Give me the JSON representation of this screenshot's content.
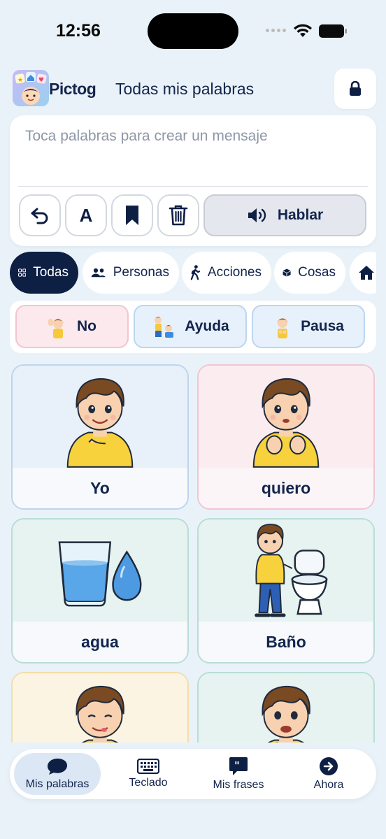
{
  "status_bar": {
    "time": "12:56"
  },
  "header": {
    "logo_text": "Pictog",
    "title": "Todas mis palabras"
  },
  "message": {
    "placeholder": "Toca palabras para crear un mensaje",
    "speak_label": "Hablar",
    "font_button_label": "A"
  },
  "categories": [
    {
      "label": "Todas",
      "icon": "grid-icon",
      "active": true
    },
    {
      "label": "Personas",
      "icon": "people-icon"
    },
    {
      "label": "Acciones",
      "icon": "walking-icon"
    },
    {
      "label": "Cosas",
      "icon": "box-icon"
    },
    {
      "label": "",
      "icon": "home-icon"
    }
  ],
  "quick_chips": [
    {
      "label": "No"
    },
    {
      "label": "Ayuda"
    },
    {
      "label": "Pausa"
    }
  ],
  "cards": [
    {
      "label": "Yo",
      "color": "blue"
    },
    {
      "label": "quiero",
      "color": "pink"
    },
    {
      "label": "agua",
      "color": "teal"
    },
    {
      "label": "Baño",
      "color": "teal"
    },
    {
      "label": "",
      "color": "yellow"
    },
    {
      "label": "",
      "color": "teal"
    }
  ],
  "nav": [
    {
      "label": "Mis palabras",
      "icon": "chat-bubble-icon",
      "active": true
    },
    {
      "label": "Teclado",
      "icon": "keyboard-icon"
    },
    {
      "label": "Mis frases",
      "icon": "quote-bubble-icon"
    },
    {
      "label": "Ahora",
      "icon": "arrow-circle-icon"
    }
  ],
  "colors": {
    "background": "#eaf2f9",
    "navy": "#0e1f44",
    "card_blue": "#e8f0fa",
    "card_pink": "#fbecf0",
    "card_teal": "#e6f3f0",
    "card_yellow": "#fcf4e2"
  }
}
